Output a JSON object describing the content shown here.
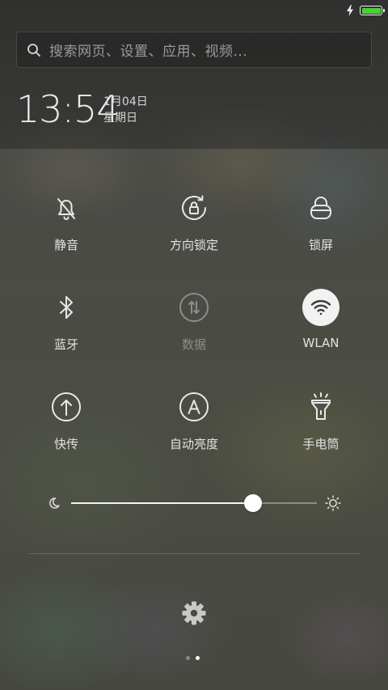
{
  "status_bar": {
    "charging": true,
    "battery_level": 1.0,
    "battery_color": "#4ad132",
    "icons": [
      "charge-icon",
      "battery-icon"
    ]
  },
  "search": {
    "placeholder": "搜索网页、设置、应用、视频..."
  },
  "clock": {
    "time": "13:54",
    "date": "1月04日",
    "weekday": "星期日"
  },
  "toggles": [
    {
      "label": "静音",
      "icon": "bell-off-icon",
      "state": "off"
    },
    {
      "label": "方向锁定",
      "icon": "rotation-lock-icon",
      "state": "off"
    },
    {
      "label": "锁屏",
      "icon": "lock-icon",
      "state": "off"
    },
    {
      "label": "蓝牙",
      "icon": "bluetooth-icon",
      "state": "off"
    },
    {
      "label": "数据",
      "icon": "mobile-data-icon",
      "state": "disabled"
    },
    {
      "label": "WLAN",
      "icon": "wifi-icon",
      "state": "on"
    },
    {
      "label": "快传",
      "icon": "quick-transfer-icon",
      "state": "off"
    },
    {
      "label": "自动亮度",
      "icon": "auto-brightness-icon",
      "state": "off"
    },
    {
      "label": "手电筒",
      "icon": "flashlight-icon",
      "state": "off"
    }
  ],
  "brightness": {
    "level": 0.74,
    "min_icon": "moon-icon",
    "max_icon": "sun-icon"
  },
  "footer": {
    "settings_icon": "gear-icon",
    "page_count": 2,
    "active_page": 1
  }
}
